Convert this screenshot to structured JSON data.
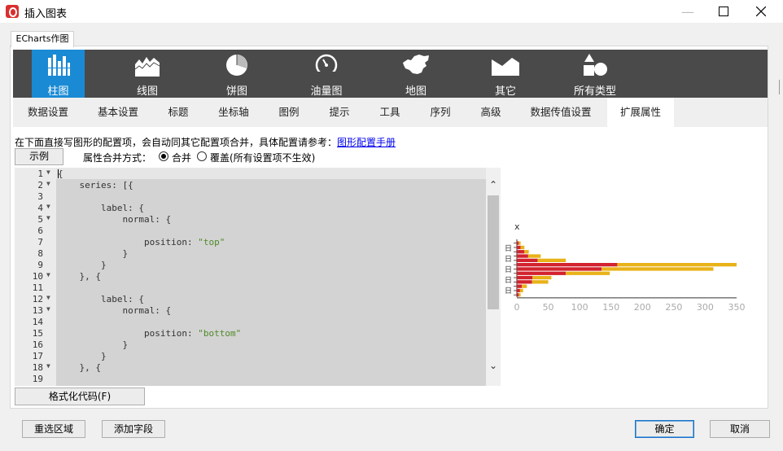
{
  "window": {
    "title": "插入图表",
    "minimize_icon": "minimize-icon",
    "maximize_icon": "maximize-icon",
    "close_icon": "close-icon"
  },
  "outer_tab": "ECharts作图",
  "chart_types": [
    {
      "label": "柱图",
      "icon": "bar-chart-icon",
      "active": true
    },
    {
      "label": "线图",
      "icon": "line-chart-icon"
    },
    {
      "label": "饼图",
      "icon": "pie-chart-icon"
    },
    {
      "label": "油量图",
      "icon": "gauge-icon"
    },
    {
      "label": "地图",
      "icon": "china-map-icon"
    },
    {
      "label": "其它",
      "icon": "area-chart-icon"
    },
    {
      "label": "所有类型",
      "icon": "shapes-icon"
    }
  ],
  "sub_tabs": [
    "数据设置",
    "基本设置",
    "标题",
    "坐标轴",
    "图例",
    "提示",
    "工具",
    "序列",
    "高级",
    "数据传值设置",
    "扩展属性"
  ],
  "active_sub_tab": "扩展属性",
  "instruction": {
    "text": "在下面直接写图形的配置项，会自动同其它配置项合并，具体配置请参考：",
    "link": "图形配置手册"
  },
  "example_button": "示例",
  "merge_mode": {
    "label": "属性合并方式：",
    "options": [
      "合并",
      "覆盖(所有设置项不生效)"
    ],
    "selected": "合并"
  },
  "code_lines": [
    {
      "n": "1",
      "fold": true,
      "indent": 0,
      "text": "{"
    },
    {
      "n": "2",
      "fold": true,
      "indent": 1,
      "text": "series: [{"
    },
    {
      "n": "3",
      "indent": 0,
      "text": ""
    },
    {
      "n": "4",
      "fold": true,
      "indent": 2,
      "text": "label: {"
    },
    {
      "n": "5",
      "fold": true,
      "indent": 3,
      "text": "normal: {"
    },
    {
      "n": "6",
      "indent": 0,
      "text": ""
    },
    {
      "n": "7",
      "indent": 4,
      "text": "position: ",
      "str": "\"top\""
    },
    {
      "n": "8",
      "indent": 3,
      "text": "}"
    },
    {
      "n": "9",
      "indent": 2,
      "text": "}"
    },
    {
      "n": "10",
      "fold": true,
      "indent": 1,
      "text": "}, {"
    },
    {
      "n": "11",
      "indent": 0,
      "text": ""
    },
    {
      "n": "12",
      "fold": true,
      "indent": 2,
      "text": "label: {"
    },
    {
      "n": "13",
      "fold": true,
      "indent": 3,
      "text": "normal: {"
    },
    {
      "n": "14",
      "indent": 0,
      "text": ""
    },
    {
      "n": "15",
      "indent": 4,
      "text": "position: ",
      "str": "\"bottom\""
    },
    {
      "n": "16",
      "indent": 3,
      "text": "}"
    },
    {
      "n": "17",
      "indent": 2,
      "text": "}"
    },
    {
      "n": "18",
      "fold": true,
      "indent": 1,
      "text": "}, {"
    },
    {
      "n": "19",
      "indent": 0,
      "text": ""
    }
  ],
  "format_button": "格式化代码(F)",
  "footer": {
    "reselect": "重选区域",
    "add_field": "添加字段",
    "ok": "确定",
    "cancel": "取消"
  },
  "chart_data": {
    "type": "bar",
    "orientation": "horizontal",
    "stacked": true,
    "ylabel": "x",
    "xlim": [
      0,
      350
    ],
    "xticks": [
      "0",
      "50",
      "100",
      "150",
      "200",
      "250",
      "300",
      "350"
    ],
    "category_tick_labels": [
      "日",
      "日",
      "日",
      "日",
      "日"
    ],
    "colors": [
      "#d2232e",
      "#e8b219"
    ],
    "series": [
      {
        "values": [
          3,
          6,
          12,
          18,
          33,
          160,
          135,
          78,
          25,
          24,
          8,
          5,
          3
        ]
      },
      {
        "values": [
          3,
          6,
          7,
          20,
          45,
          190,
          178,
          70,
          30,
          26,
          8,
          5,
          3
        ]
      }
    ]
  }
}
